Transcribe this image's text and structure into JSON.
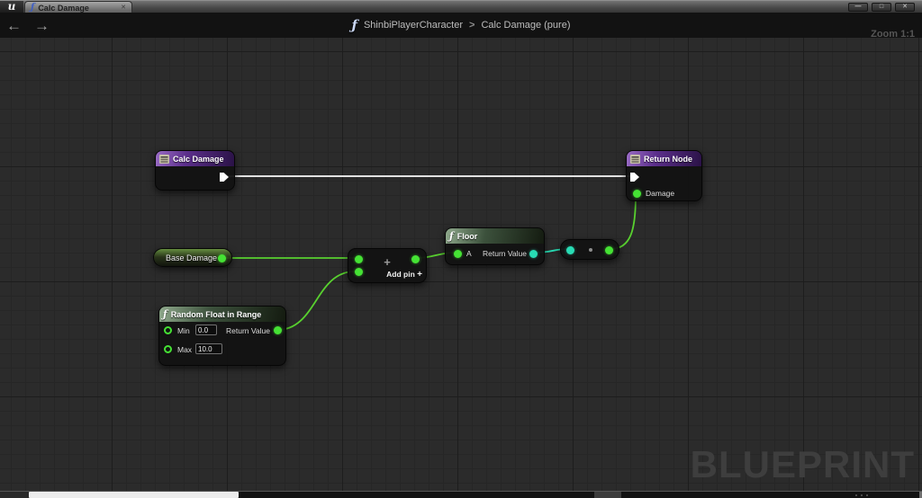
{
  "window": {
    "logo": "u",
    "tab": {
      "icon": "ƒ",
      "title": "Calc Damage",
      "close_icon": "✕"
    },
    "controls": {
      "minimize": "—",
      "maximize": "□",
      "close": "✕"
    }
  },
  "toolbar": {
    "back_icon": "←",
    "forward_icon": "→",
    "function_icon": "ƒ",
    "breadcrumb_parent": "ShinbiPlayerCharacter",
    "breadcrumb_separator": ">",
    "breadcrumb_current": "Calc Damage (pure)",
    "zoom_label": "Zoom 1:1"
  },
  "graph": {
    "watermark": "BLUEPRINT",
    "nodes": {
      "calc_damage": {
        "title": "Calc Damage"
      },
      "return_node": {
        "title": "Return Node",
        "damage_pin_label": "Damage"
      },
      "base_damage": {
        "title": "Base Damage"
      },
      "add": {
        "operator": "+",
        "add_pin_label": "Add pin ",
        "add_pin_icon": "+"
      },
      "floor": {
        "icon": "ƒ",
        "title": "Floor",
        "input_label": "A",
        "output_label": "Return Value"
      },
      "random_float_in_range": {
        "icon": "ƒ",
        "title": "Random Float in Range",
        "min_label": "Min",
        "min_value": "0.0",
        "max_label": "Max",
        "max_value": "10.0",
        "output_label": "Return Value"
      }
    }
  },
  "colors": {
    "float_pin": "#45e234",
    "int_pin": "#28dcb4",
    "exec_wire": "#e2e2e2",
    "wire_green": "#58d02f",
    "header_purple": "#9a6cc5",
    "header_green": "#8fa98c",
    "grid_bg": "#2b2b2b"
  }
}
